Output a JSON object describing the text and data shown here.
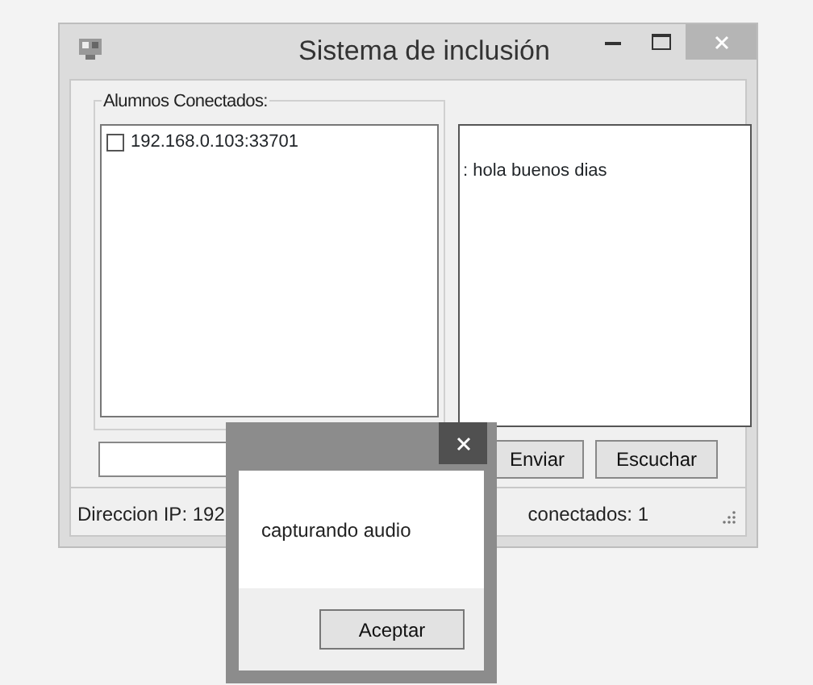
{
  "window": {
    "title": "Sistema de inclusión"
  },
  "group": {
    "label": "Alumnos Conectados:",
    "items": [
      {
        "text": "192.168.0.103:33701",
        "checked": false
      }
    ]
  },
  "chat": {
    "text": ": hola buenos dias"
  },
  "buttons": [
    {
      "label": "Enviar"
    },
    {
      "label": "Escuchar"
    }
  ],
  "status_bar": [
    "Direccion IP: 192",
    "conectados: 1"
  ],
  "dialog": {
    "message": "capturando audio",
    "button": "Aceptar"
  }
}
